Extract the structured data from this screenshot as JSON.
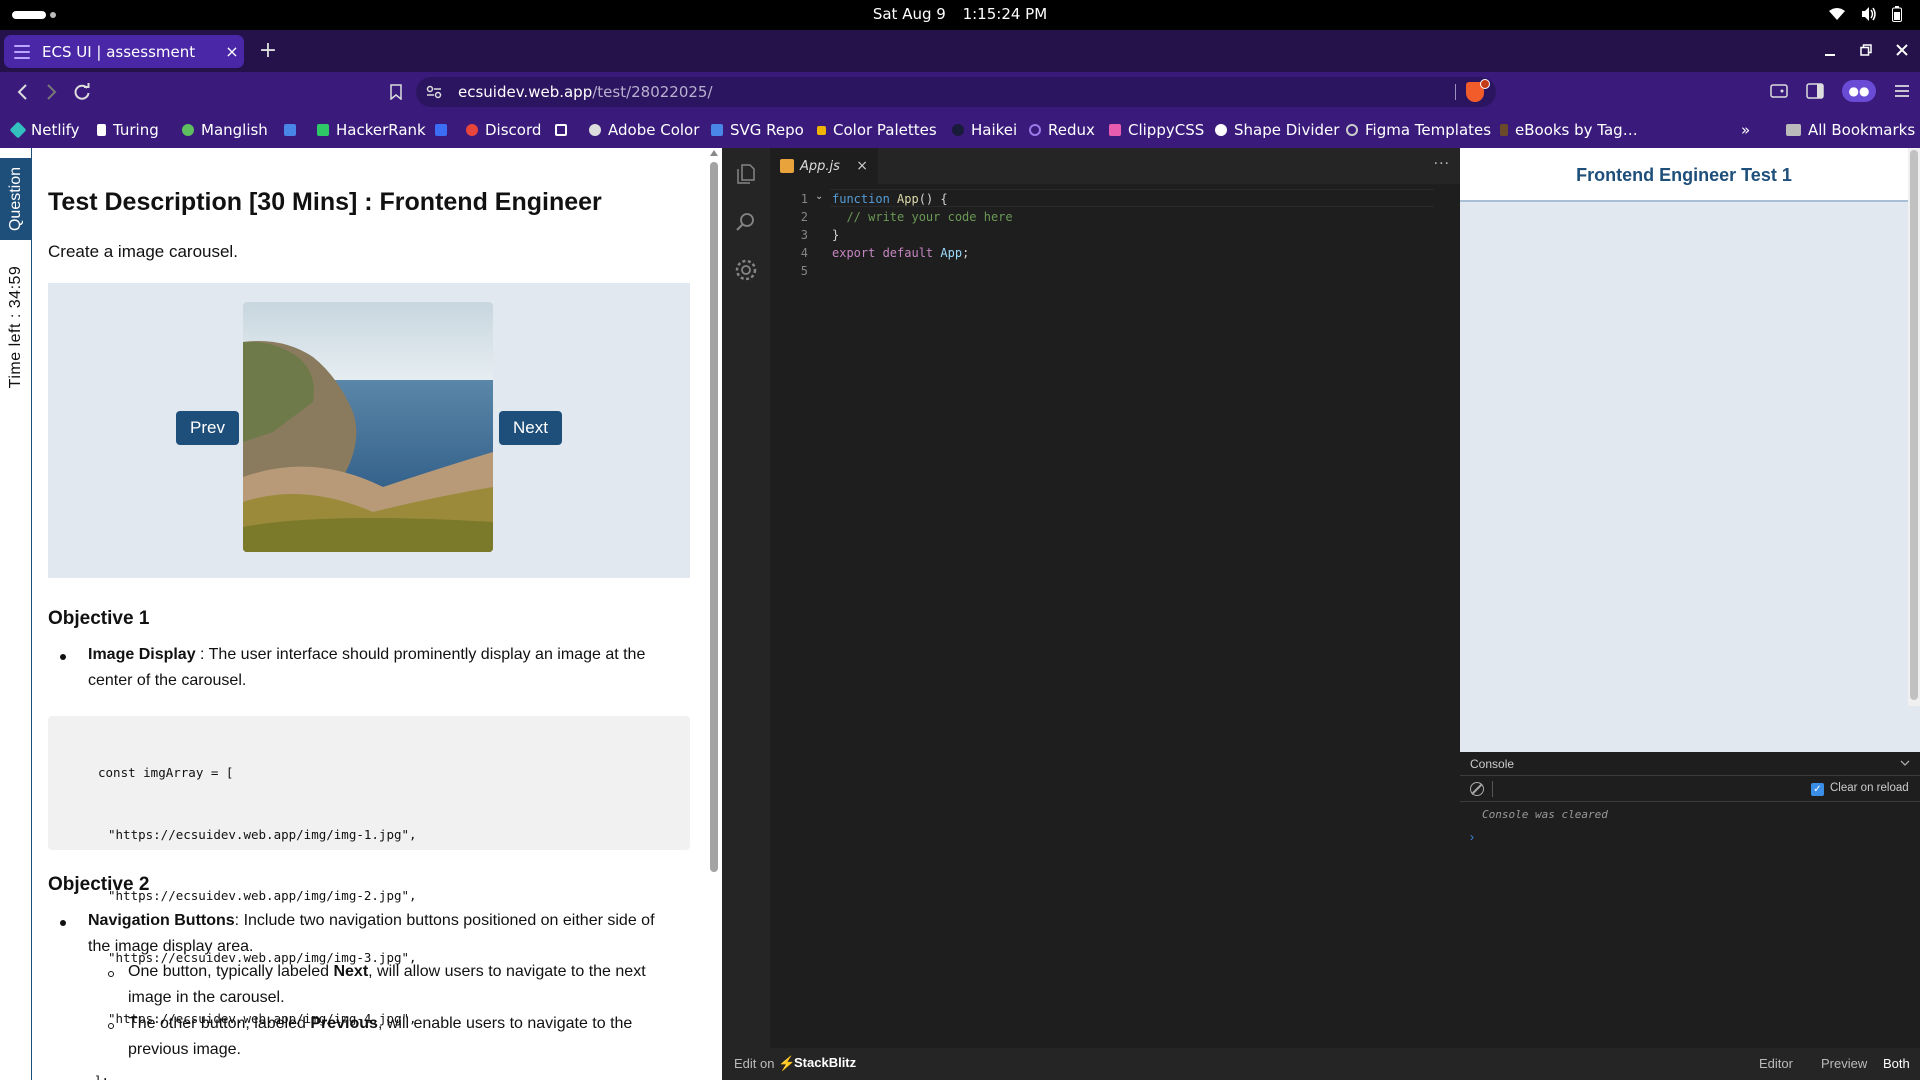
{
  "system": {
    "date": "Sat Aug 9",
    "time": "1:15:24 PM"
  },
  "browser": {
    "tab_title": "ECS UI | assessment",
    "tab_close": "×",
    "new_tab": "+",
    "url_host": "ecsuidev.web.app",
    "url_path": "/test/28022025/",
    "bookmarks": [
      {
        "label": "Netlify",
        "color": "#32bfbd"
      },
      {
        "label": "Turing",
        "color": "#ffffff"
      },
      {
        "label": "Manglish",
        "color": "#5fbf5f"
      },
      {
        "label": "",
        "color": "#4a86e8"
      },
      {
        "label": "HackerRank",
        "color": "#2ec866"
      },
      {
        "label": "",
        "color": "#3b6ef5"
      },
      {
        "label": "Discord",
        "color": "#e8453c"
      },
      {
        "label": "",
        "color": "#ffffff"
      },
      {
        "label": "Adobe Color",
        "color": "#dddddd"
      },
      {
        "label": "SVG Repo",
        "color": "#4a86e8"
      },
      {
        "label": "Color Palettes",
        "color": "#f0b400"
      },
      {
        "label": "Haikei",
        "color": "#1a1a3a"
      },
      {
        "label": "Redux",
        "color": "#9b7ae8"
      },
      {
        "label": "ClippyCSS",
        "color": "#e85cb0"
      },
      {
        "label": "Shape Divider",
        "color": "#ffffff"
      },
      {
        "label": "Figma Templates",
        "color": "#cccccc"
      },
      {
        "label": "eBooks by Tag…",
        "color": "#6b4a2a"
      }
    ],
    "bookmarks_overflow": "»",
    "all_bookmarks": "All Bookmarks"
  },
  "sidebar": {
    "question_tab": "Question",
    "timer": "Time left : 34:59"
  },
  "question": {
    "title": "Test Description [30 Mins] : Frontend Engineer",
    "description": "Create a image carousel.",
    "carousel": {
      "prev_label": "Prev",
      "next_label": "Next"
    },
    "objective1_title": "Objective 1",
    "objective1_strong": "Image Display",
    "objective1_text": " : The user interface should prominently display an image at the center of the carousel.",
    "code_lines": [
      "const imgArray = [",
      "\"https://ecsuidev.web.app/img/img-1.jpg\",",
      "\"https://ecsuidev.web.app/img/img-2.jpg\",",
      "\"https://ecsuidev.web.app/img/img-3.jpg\",",
      "\"https://ecsuidev.web.app/img/img-4.jpg\",",
      "];"
    ],
    "objective2_title": "Objective 2",
    "objective2_strong": "Navigation Buttons",
    "objective2_text": ": Include two navigation buttons positioned on either side of the image display area.",
    "sub1_pre": "One button, typically labeled ",
    "sub1_strong": "Next",
    "sub1_post": ", will allow users to navigate to the next image in the carousel.",
    "sub2_pre": "The other button, labeled ",
    "sub2_strong": "Previous",
    "sub2_post": ", will enable users to navigate to the previous image."
  },
  "editor": {
    "tab_label": "App.js",
    "tab_close": "×",
    "more": "···",
    "line_numbers": [
      "1",
      "2",
      "3",
      "4",
      "5"
    ]
  },
  "preview": {
    "heading": "Frontend Engineer Test 1"
  },
  "console": {
    "title": "Console",
    "clear_on_reload": "Clear on reload",
    "message": "Console was cleared",
    "prompt": "›"
  },
  "statusbar": {
    "edit_on": "Edit on",
    "brand": "StackBlitz",
    "editor_btn": "Editor",
    "preview_btn": "Preview",
    "both_btn": "Both"
  }
}
